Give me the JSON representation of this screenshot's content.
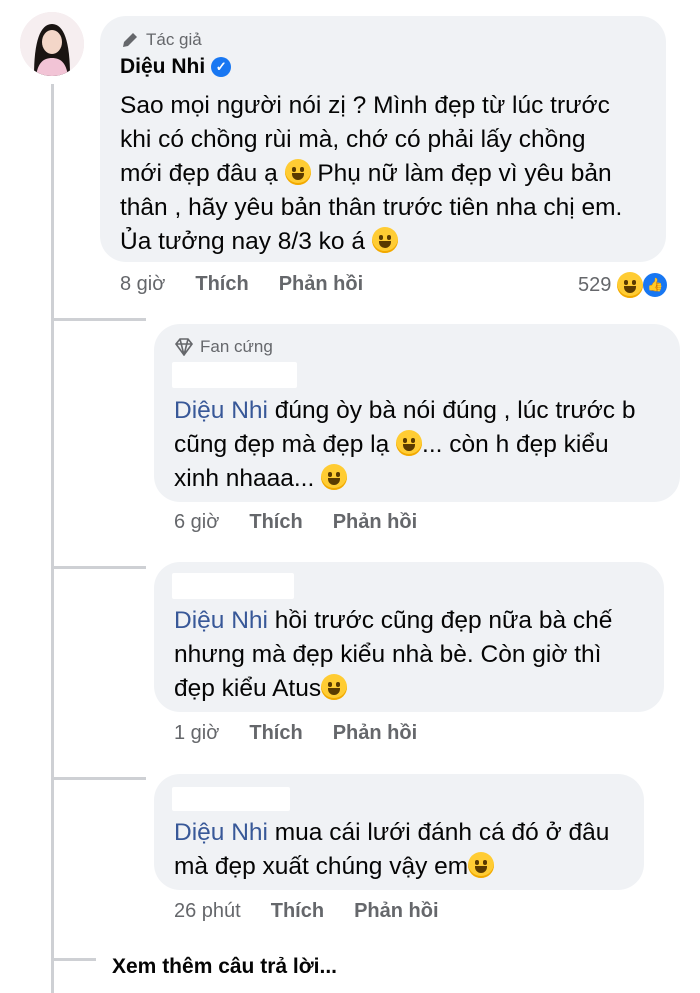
{
  "comment": {
    "badge": "Tác giả",
    "author": "Diệu Nhi",
    "lines": [
      "Sao mọi người nói zị ? Mình đẹp từ lúc trước",
      "khi có chồng rùi mà, chớ có phải lấy chồng",
      "mới đẹp đâu ạ",
      " Phụ nữ làm đẹp vì yêu bản",
      "thân , hãy yêu bản thân trước tiên nha chị em.",
      "Ủa tưởng nay 8/3 ko á"
    ],
    "time": "8 giờ",
    "like": "Thích",
    "reply": "Phản hồi",
    "reaction_count": "529"
  },
  "replies": [
    {
      "badge": "Fan cứng",
      "mention": "Diệu Nhi",
      "lines": [
        " đúng òy bà nói đúng , lúc trước b",
        "cũng đẹp mà đẹp lạ",
        "... còn h đẹp kiểu",
        "xinh nhaaa..."
      ],
      "time": "6 giờ",
      "like": "Thích",
      "reply": "Phản hồi"
    },
    {
      "mention": "Diệu Nhi",
      "lines": [
        " hồi trước cũng đẹp nữa bà chế",
        "nhưng mà đẹp kiểu nhà bè. Còn giờ thì",
        "đẹp kiểu Atus"
      ],
      "time": "1 giờ",
      "like": "Thích",
      "reply": "Phản hồi"
    },
    {
      "mention": "Diệu Nhi",
      "lines": [
        " mua cái lưới đánh cá đó ở đâu",
        "mà đẹp xuất chúng vậy em"
      ],
      "time": "26 phút",
      "like": "Thích",
      "reply": "Phản hồi"
    }
  ],
  "more_replies": "Xem thêm câu trả lời...",
  "colors": {
    "bubble": "#f0f2f5",
    "mention": "#385898",
    "meta": "#65676b",
    "verified": "#1877f2"
  },
  "icons": [
    "pencil-icon",
    "verified-icon",
    "diamond-icon",
    "laughing-emoji",
    "like-reaction-icon"
  ]
}
